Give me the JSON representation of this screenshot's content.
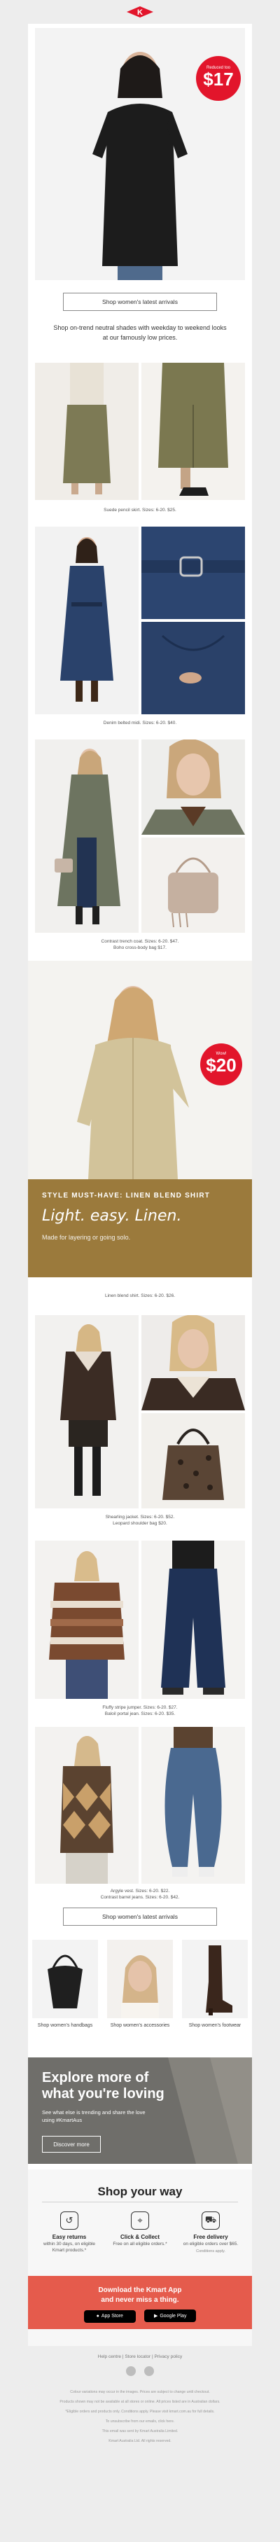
{
  "brand": {
    "logo": "K",
    "accent": "#e2152b"
  },
  "hero": {
    "badge_small": "Reduced too",
    "badge_price": "$17",
    "cta": "Shop women's latest arrivals",
    "tagline": "Shop on-trend neutral shades with weekday to weekend looks at our famously low prices."
  },
  "products": {
    "skirt": "Suede pencil skirt. Sizes: 6-20. $25.",
    "midi": "Denim belted midi. Sizes: 6-20. $40.",
    "trench_line1": "Contrast trench coat. Sizes: 6-20. $47.",
    "trench_line2": "Boho cross-body bag $17.",
    "linen": "Linen blend shirt. Sizes: 6-20. $26.",
    "shearling_line1": "Shearling jacket. Sizes: 6-20. $52.",
    "shearling_line2": "Leopard shoulder bag $20.",
    "jumper_line1": "Fluffy stripe jumper. Sizes: 6-20. $27.",
    "jumper_line2": "Baloil portal jean. Sizes: 6-20. $35.",
    "argyle_line1": "Argyle vest. Sizes: 6-20. $22.",
    "argyle_line2": "Contrast barrel jeans. Sizes: 6-20. $42."
  },
  "linen_feature": {
    "badge_small": "Wow!",
    "badge_price": "$20",
    "kicker": "STYLE MUST-HAVE: LINEN BLEND SHIRT",
    "headline": "Light. easy. Linen.",
    "desc": "Made for layering or going solo."
  },
  "cta2": "Shop women's latest arrivals",
  "categories": [
    {
      "label": "Shop women's handbags"
    },
    {
      "label": "Shop women's accessories"
    },
    {
      "label": "Shop women's footwear"
    }
  ],
  "explore": {
    "title": "Explore more of what you're loving",
    "desc": "See what else is trending and share the love using #KmartAus",
    "button": "Discover more"
  },
  "shop_your_way": {
    "title": "Shop your way",
    "services": [
      {
        "icon": "returns-icon",
        "title": "Easy returns",
        "desc": "within 30 days, on eligible Kmart products.*",
        "note": ""
      },
      {
        "icon": "click-collect-icon",
        "title": "Click & Collect",
        "desc": "Free on all eligible orders.*",
        "note": ""
      },
      {
        "icon": "truck-icon",
        "title": "Free delivery",
        "desc": "on eligible orders over $65.",
        "note": "Conditions apply."
      }
    ]
  },
  "app": {
    "title_line1": "Download the Kmart App",
    "title_line2": "and never miss a thing.",
    "app_store": "App Store",
    "google_play": "Google Play"
  },
  "footer": {
    "links": "Help centre  |  Store locator  |  Privacy policy",
    "fine1": "Colour variations may occur in the images. Prices are subject to change until checkout.",
    "fine2": "Products shown may not be available at all stores or online. All prices listed are in Australian dollars.",
    "fine3": "*Eligible orders and products only. Conditions apply. Please visit kmart.com.au for full details.",
    "fine4": "To unsubscribe from our emails, click here.",
    "fine5": "This email was sent by Kmart Australia Limited.",
    "fine6": "Kmart Australia Ltd. All rights reserved."
  }
}
